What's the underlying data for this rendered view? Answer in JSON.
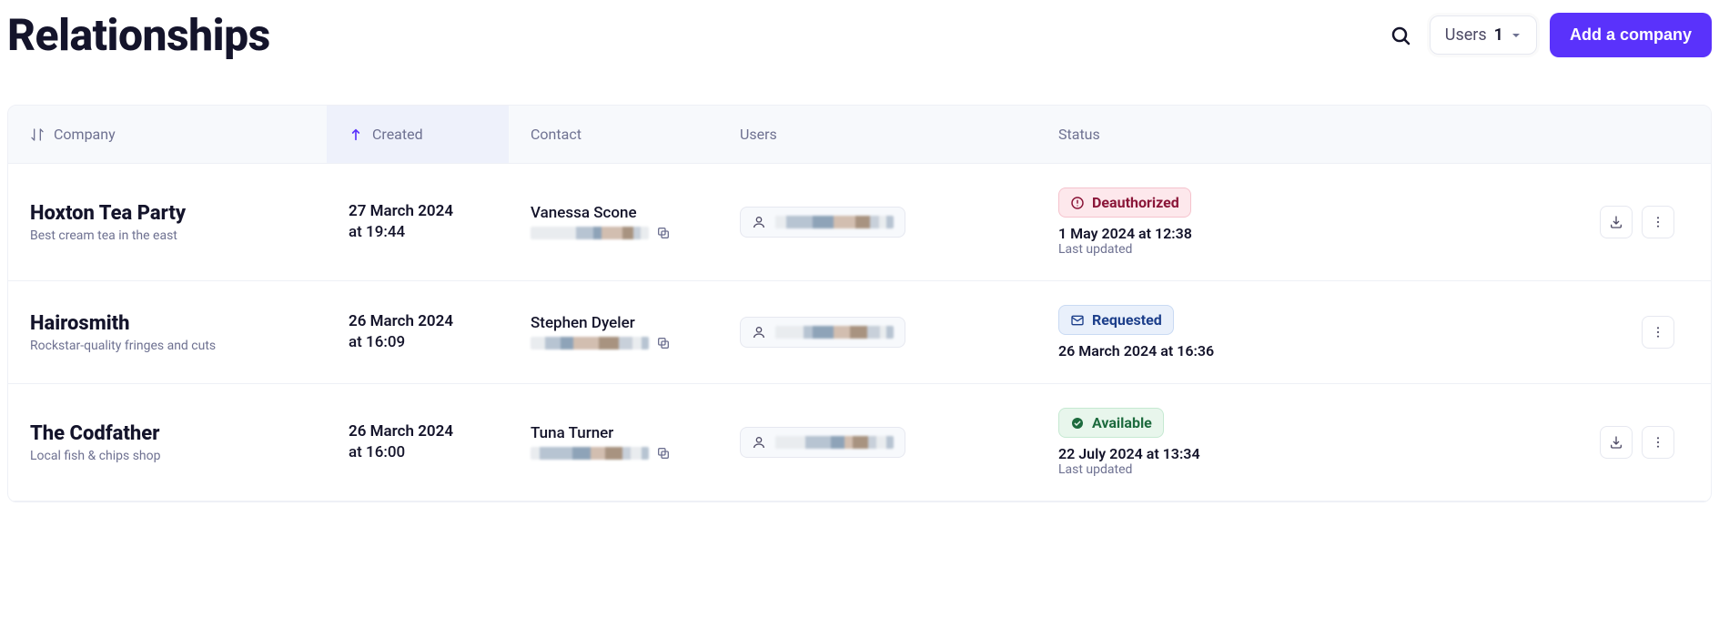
{
  "header": {
    "title": "Relationships",
    "users_filter_label": "Users",
    "users_filter_count": "1",
    "add_company_label": "Add a company"
  },
  "columns": {
    "company": "Company",
    "created": "Created",
    "contact": "Contact",
    "users": "Users",
    "status": "Status"
  },
  "rows": [
    {
      "company_name": "Hoxton Tea Party",
      "company_tag": "Best cream tea in the east",
      "created_date": "27 March 2024",
      "created_time": "at 19:44",
      "contact_name": "Vanessa Scone",
      "status_key": "deauthorized",
      "status_label": "Deauthorized",
      "status_date": "1 May 2024 at 12:38",
      "status_sub": "Last updated",
      "show_download": true
    },
    {
      "company_name": "Hairosmith",
      "company_tag": "Rockstar-quality fringes and cuts",
      "created_date": "26 March 2024",
      "created_time": "at 16:09",
      "contact_name": "Stephen Dyeler",
      "status_key": "requested",
      "status_label": "Requested",
      "status_date": "26 March 2024 at 16:36",
      "status_sub": "",
      "show_download": false
    },
    {
      "company_name": "The Codfather",
      "company_tag": "Local fish & chips shop",
      "created_date": "26 March 2024",
      "created_time": "at 16:00",
      "contact_name": "Tuna Turner",
      "status_key": "available",
      "status_label": "Available",
      "status_date": "22 July 2024 at 13:34",
      "status_sub": "Last updated",
      "show_download": true
    }
  ]
}
